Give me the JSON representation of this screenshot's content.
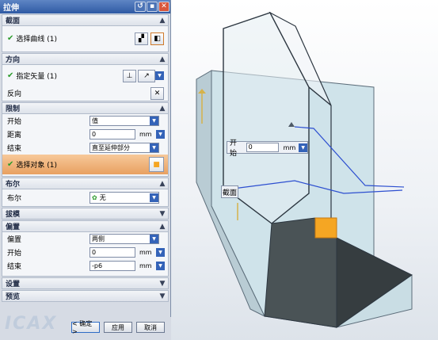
{
  "dialog": {
    "title": "拉伸"
  },
  "section": {
    "profile": {
      "header": "截面",
      "select_curve": "选择曲线 (1)"
    },
    "direction": {
      "header": "方向",
      "specify_vector": "指定矢量 (1)",
      "reverse": "反向"
    },
    "limits": {
      "header": "限制",
      "start_label": "开始",
      "start_value": "值",
      "distance_label": "距离",
      "distance_value": "0",
      "distance_unit": "mm",
      "end_label": "结束",
      "end_value": "直至延伸部分",
      "select_object": "选择对象 (1)"
    },
    "boolean": {
      "header": "布尔",
      "label": "布尔",
      "value": "无"
    },
    "draft": {
      "header": "拔模"
    },
    "offset": {
      "header": "偏置",
      "offset_label": "偏置",
      "offset_value": "两侧",
      "start_label": "开始",
      "start_value": "0",
      "start_unit": "mm",
      "end_label": "结束",
      "end_value": "-p6",
      "end_unit": "mm"
    },
    "settings": {
      "header": "设置"
    },
    "preview": {
      "header": "预览"
    }
  },
  "footer": {
    "ok": "< 确定 >",
    "apply": "应用",
    "cancel": "取消"
  },
  "viewport": {
    "start_tag": {
      "label": "开始",
      "value": "0",
      "unit": "mm"
    },
    "section_tag": {
      "label": "截面"
    },
    "watermark": "ICAX"
  },
  "colors": {
    "title_bar": "#2f5aa4",
    "accent_orange": "#f5a623",
    "check": "#2a9a2a"
  }
}
